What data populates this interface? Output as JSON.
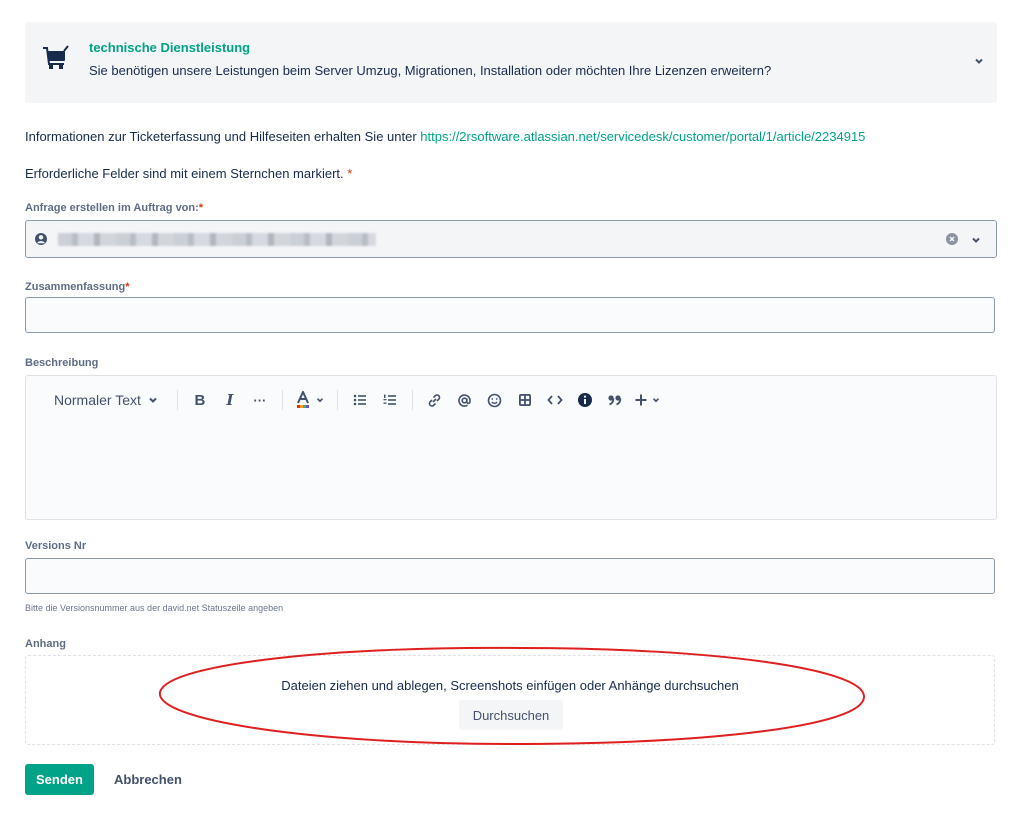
{
  "request_type": {
    "title": "technische Dienstleistung",
    "description": "Sie benötigen unsere Leistungen beim Server Umzug, Migrationen, Installation oder möchten Ihre Lizenzen erweitern?",
    "icon": "cart-icon"
  },
  "info": {
    "text": "Informationen zur Ticketerfassung und Hilfeseiten erhalten Sie unter ",
    "link": "https://2rsoftware.atlassian.net/servicedesk/customer/portal/1/article/2234915"
  },
  "required_note": "Erforderliche Felder sind mit einem Sternchen markiert.",
  "required_marker": "*",
  "fields": {
    "on_behalf": {
      "label": "Anfrage erstellen im Auftrag von:"
    },
    "summary": {
      "label": "Zusammenfassung",
      "value": ""
    },
    "description": {
      "label": "Beschreibung"
    },
    "version": {
      "label": "Versions Nr",
      "value": "",
      "helper": "Bitte die Versionsnummer aus der david.net Statuszeile angeben"
    },
    "attachment": {
      "label": "Anhang",
      "drop_text": "Dateien ziehen und ablegen, Screenshots einfügen oder Anhänge durchsuchen",
      "browse_label": "Durchsuchen"
    }
  },
  "editor_toolbar": {
    "text_style": "Normaler Text",
    "bold": "B",
    "italic": "I",
    "more": "···"
  },
  "actions": {
    "submit": "Senden",
    "cancel": "Abbrechen"
  },
  "colors": {
    "accent": "#00a387",
    "required": "#de350b",
    "highlight": "#e02020"
  }
}
